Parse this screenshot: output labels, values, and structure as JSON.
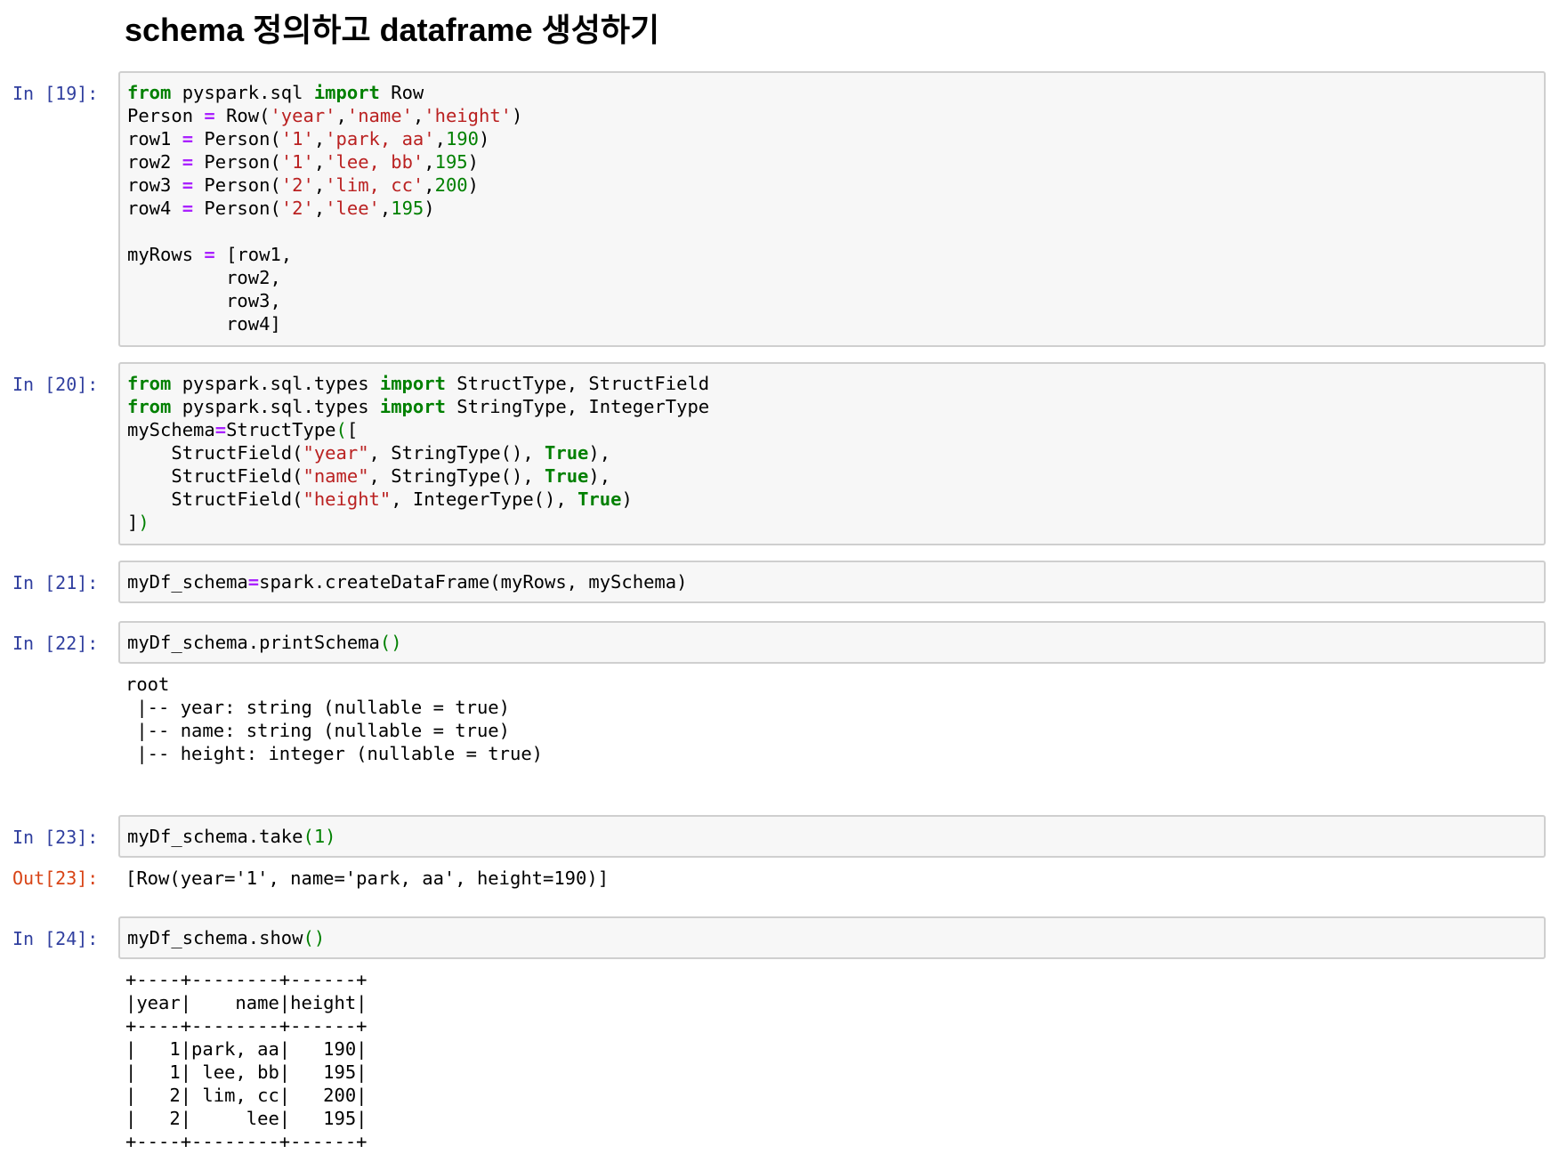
{
  "heading": "schema 정의하고 dataframe 생성하기",
  "colors": {
    "prompt_in": "#303f9f",
    "prompt_out": "#d84315",
    "keyword": "#008000",
    "string": "#ba2121",
    "number": "#008000",
    "operator": "#aa22ff"
  },
  "cells": {
    "c19": {
      "prompt": "In [19]:",
      "lines": [
        [
          [
            "kw",
            "from"
          ],
          [
            "t",
            " pyspark.sql "
          ],
          [
            "kw",
            "import"
          ],
          [
            "t",
            " Row"
          ]
        ],
        [
          [
            "t",
            "Person "
          ],
          [
            "op",
            "="
          ],
          [
            "t",
            " Row("
          ],
          [
            "st",
            "'year'"
          ],
          [
            "t",
            ","
          ],
          [
            "st",
            "'name'"
          ],
          [
            "t",
            ","
          ],
          [
            "st",
            "'height'"
          ],
          [
            "t",
            ")"
          ]
        ],
        [
          [
            "t",
            "row1 "
          ],
          [
            "op",
            "="
          ],
          [
            "t",
            " Person("
          ],
          [
            "st",
            "'1'"
          ],
          [
            "t",
            ","
          ],
          [
            "st",
            "'park, aa'"
          ],
          [
            "t",
            ","
          ],
          [
            "nu",
            "190"
          ],
          [
            "t",
            ")"
          ]
        ],
        [
          [
            "t",
            "row2 "
          ],
          [
            "op",
            "="
          ],
          [
            "t",
            " Person("
          ],
          [
            "st",
            "'1'"
          ],
          [
            "t",
            ","
          ],
          [
            "st",
            "'lee, bb'"
          ],
          [
            "t",
            ","
          ],
          [
            "nu",
            "195"
          ],
          [
            "t",
            ")"
          ]
        ],
        [
          [
            "t",
            "row3 "
          ],
          [
            "op",
            "="
          ],
          [
            "t",
            " Person("
          ],
          [
            "st",
            "'2'"
          ],
          [
            "t",
            ","
          ],
          [
            "st",
            "'lim, cc'"
          ],
          [
            "t",
            ","
          ],
          [
            "nu",
            "200"
          ],
          [
            "t",
            ")"
          ]
        ],
        [
          [
            "t",
            "row4 "
          ],
          [
            "op",
            "="
          ],
          [
            "t",
            " Person("
          ],
          [
            "st",
            "'2'"
          ],
          [
            "t",
            ","
          ],
          [
            "st",
            "'lee'"
          ],
          [
            "t",
            ","
          ],
          [
            "nu",
            "195"
          ],
          [
            "t",
            ")"
          ]
        ],
        [],
        [
          [
            "t",
            "myRows "
          ],
          [
            "op",
            "="
          ],
          [
            "t",
            " [row1,"
          ]
        ],
        [
          [
            "t",
            "         row2,"
          ]
        ],
        [
          [
            "t",
            "         row3,"
          ]
        ],
        [
          [
            "t",
            "         row4]"
          ]
        ]
      ]
    },
    "c20": {
      "prompt": "In [20]:",
      "lines": [
        [
          [
            "kw",
            "from"
          ],
          [
            "t",
            " pyspark.sql.types "
          ],
          [
            "kw",
            "import"
          ],
          [
            "t",
            " StructType, StructField"
          ]
        ],
        [
          [
            "kw",
            "from"
          ],
          [
            "t",
            " pyspark.sql.types "
          ],
          [
            "kw",
            "import"
          ],
          [
            "t",
            " StringType, IntegerType"
          ]
        ],
        [
          [
            "t",
            "mySchema"
          ],
          [
            "op",
            "="
          ],
          [
            "t",
            "StructType"
          ],
          [
            "pa",
            "("
          ],
          [
            "t",
            "["
          ]
        ],
        [
          [
            "t",
            "    StructField("
          ],
          [
            "st",
            "\"year\""
          ],
          [
            "t",
            ", StringType(), "
          ],
          [
            "kw",
            "True"
          ],
          [
            "t",
            "),"
          ]
        ],
        [
          [
            "t",
            "    StructField("
          ],
          [
            "st",
            "\"name\""
          ],
          [
            "t",
            ", StringType(), "
          ],
          [
            "kw",
            "True"
          ],
          [
            "t",
            "),"
          ]
        ],
        [
          [
            "t",
            "    StructField("
          ],
          [
            "st",
            "\"height\""
          ],
          [
            "t",
            ", IntegerType(), "
          ],
          [
            "kw",
            "True"
          ],
          [
            "t",
            ")"
          ]
        ],
        [
          [
            "t",
            "]"
          ],
          [
            "pa",
            ")"
          ]
        ]
      ]
    },
    "c21": {
      "prompt": "In [21]:",
      "lines": [
        [
          [
            "t",
            "myDf_schema"
          ],
          [
            "op",
            "="
          ],
          [
            "t",
            "spark.createDataFrame(myRows, mySchema)"
          ]
        ]
      ]
    },
    "c22": {
      "prompt": "In [22]:",
      "lines": [
        [
          [
            "t",
            "myDf_schema.printSchema"
          ],
          [
            "pa",
            "()"
          ]
        ]
      ],
      "output": "root\n |-- year: string (nullable = true)\n |-- name: string (nullable = true)\n |-- height: integer (nullable = true)"
    },
    "c23": {
      "prompt": "In [23]:",
      "lines": [
        [
          [
            "t",
            "myDf_schema.take"
          ],
          [
            "pa",
            "("
          ],
          [
            "nu",
            "1"
          ],
          [
            "pa",
            ")"
          ]
        ]
      ],
      "out_prompt": "Out[23]:",
      "output": "[Row(year='1', name='park, aa', height=190)]"
    },
    "c24": {
      "prompt": "In [24]:",
      "lines": [
        [
          [
            "t",
            "myDf_schema.show"
          ],
          [
            "pa",
            "()"
          ]
        ]
      ],
      "output": "+----+--------+------+\n|year|    name|height|\n+----+--------+------+\n|   1|park, aa|   190|\n|   1| lee, bb|   195|\n|   2| lim, cc|   200|\n|   2|     lee|   195|\n+----+--------+------+"
    }
  }
}
